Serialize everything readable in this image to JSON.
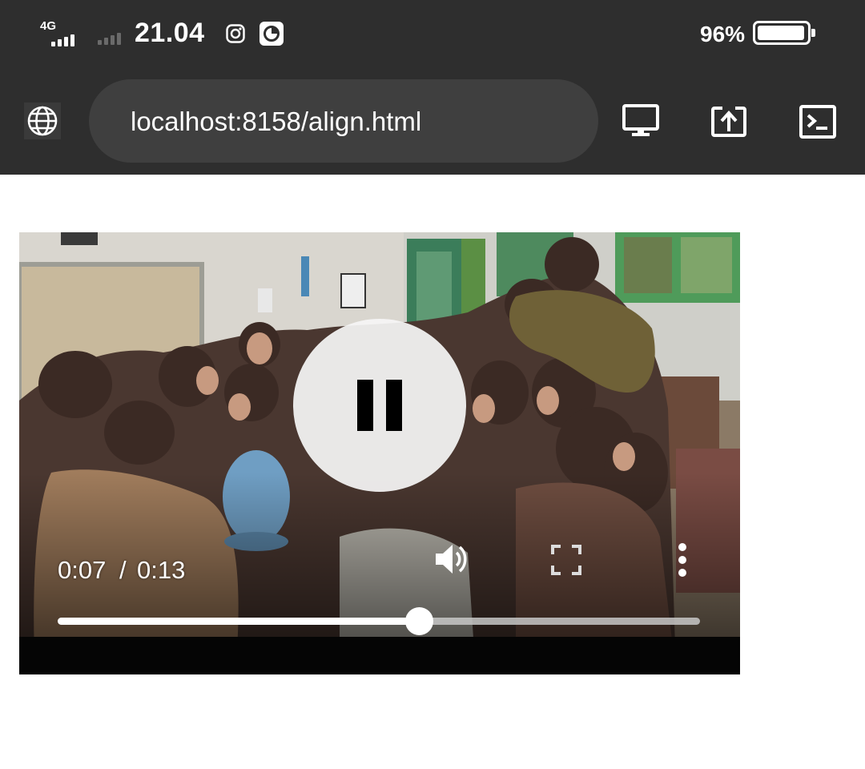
{
  "status_bar": {
    "network_label": "4G",
    "time": "21.04",
    "battery_percent": "96%",
    "battery_level": 0.96,
    "icons": [
      "signal-4g-icon",
      "signal-sim2-icon",
      "instagram-icon",
      "pie-chart-icon",
      "battery-icon"
    ]
  },
  "toolbar": {
    "url": "localhost:8158/align.html",
    "icons": [
      "globe-icon",
      "desktop-icon",
      "share-icon",
      "terminal-icon"
    ]
  },
  "video": {
    "current_time": "0:07",
    "separator": "/",
    "total_time": "0:13",
    "progress": 0.5625,
    "state": "playing",
    "icons": [
      "pause-icon",
      "volume-icon",
      "fullscreen-icon",
      "more-vertical-icon"
    ]
  },
  "colors": {
    "chrome_background": "#2e2e2e",
    "url_bar_background": "#3f3f3f",
    "page_background": "#ffffff"
  }
}
